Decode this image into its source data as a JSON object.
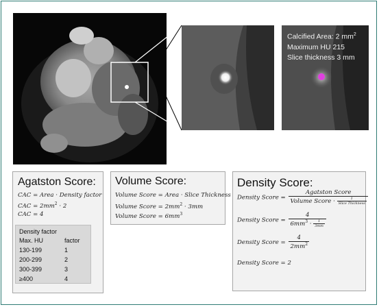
{
  "overlay": {
    "line1": "Calcified Area: 2 mm",
    "line1_sup": "2",
    "line2": "Maximum HU 215",
    "line3": "Slice thickness 3 mm"
  },
  "agatston": {
    "title": "Agatston Score:",
    "eq1": "CAC = Area · Density factor",
    "eq2_a": "CAC = 2mm",
    "eq2_sup": "2",
    "eq2_b": " · 2",
    "eq3": "CAC = 4",
    "table": {
      "title": "Density factor",
      "col1": "Max. HU",
      "col2": "factor",
      "rows": [
        {
          "hu": "130-199",
          "factor": "1"
        },
        {
          "hu": "200-299",
          "factor": "2"
        },
        {
          "hu": "300-399",
          "factor": "3"
        },
        {
          "hu": "≥400",
          "factor": "4"
        }
      ]
    }
  },
  "volume": {
    "title": "Volume Score:",
    "eq1": "Volume Score = Area · Slice Thickness",
    "eq2_a": "Volume Score = 2mm",
    "eq2_sup": "2",
    "eq2_b": " · 3mm",
    "eq3_a": "Volume Score = 6mm",
    "eq3_sup": "3"
  },
  "density": {
    "title": "Density Score:",
    "lhs": "Density Score =",
    "f1_num": "Agatston Score",
    "f1_den": "Volume Score ·",
    "f1_small_num": "1",
    "f1_small_den": "Slice Thickness",
    "f2_num": "4",
    "f2_den_a": "6mm",
    "f2_den_sup": "3",
    "f2_den_b": " ·",
    "f2_small_num": "1",
    "f2_small_den": "3mm",
    "f3_num": "4",
    "f3_den_a": "2mm",
    "f3_den_sup": "2",
    "result": "Density Score = 2"
  },
  "colors": {
    "frame_border": "#2e7b74",
    "box_bg": "#f2f2f2",
    "table_bg": "#d9d9d9",
    "highlight": "#e040e0"
  }
}
